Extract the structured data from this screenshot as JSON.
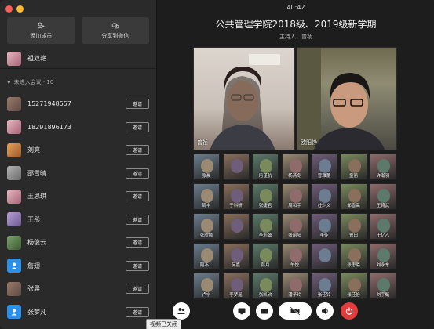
{
  "sidebar": {
    "add_member": "添加成员",
    "share_wechat": "分享到微信",
    "host_name": "祖双艳",
    "not_joined_title": "未进入会议 · 10",
    "invite_label": "邀请",
    "participants": [
      {
        "name": "15271948557",
        "avatar": "av-photo"
      },
      {
        "name": "18291896173",
        "avatar": "av-pink"
      },
      {
        "name": "刘爽",
        "avatar": "av-orange"
      },
      {
        "name": "邵雪晴",
        "avatar": "av-gray"
      },
      {
        "name": "王思琪",
        "avatar": "av-pink"
      },
      {
        "name": "王彤",
        "avatar": "av-purple"
      },
      {
        "name": "杨俊云",
        "avatar": "av-green"
      },
      {
        "name": "詹翅",
        "avatar": "av-blue"
      },
      {
        "name": "张晨",
        "avatar": "av-photo"
      },
      {
        "name": "张梦凡",
        "avatar": "av-blue"
      }
    ]
  },
  "main": {
    "clock": "40:42",
    "title": "公共管理学院2018级、2019级新学期",
    "host_line": "主持人：曾祯",
    "video1_name": "曾祯",
    "video2_name": "欧阳铮",
    "grid_names": [
      "张晨",
      "",
      "冯谨航",
      "杨燕冬",
      "曹雅蕾",
      "童丽",
      "许瀚羽",
      "周丰",
      "于科研",
      "张婕君",
      "周和宇",
      "杜少文",
      "邹雪高",
      "王诗武",
      "张欣颖",
      "",
      "李莉蹲",
      "张丽阳",
      "李佳",
      "曹田",
      "于亿乙",
      "阿不...",
      "何嘉",
      "彭月",
      "午悦",
      "",
      "张思璐",
      "刘永东",
      "卢宁",
      "李梦遥",
      "张凯欣",
      "潘子玲",
      "张佳铃",
      "张佳怡",
      "刘宇甄"
    ],
    "tooltip": "视频已关闭"
  },
  "colors": {
    "accent_red": "#e23c3c",
    "traffic_red": "#fe5f57",
    "traffic_yellow": "#febc2e",
    "blue_avatar": "#2e8fe6"
  }
}
